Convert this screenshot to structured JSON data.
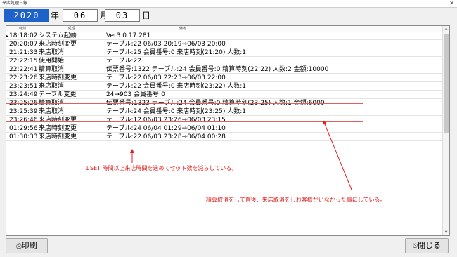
{
  "window": {
    "title": "来店処理日報",
    "close_glyph": "✕"
  },
  "date": {
    "year": "2020",
    "year_label": "年",
    "month": "06",
    "month_label": "月",
    "day": "03",
    "day_label": "日"
  },
  "list": {
    "headers": {
      "time": "時刻",
      "action": "処理",
      "detail": "備考"
    },
    "row_marker": "▸",
    "rows": [
      {
        "time": "18:18:02",
        "action": "システム起動",
        "detail": "Ver3.0.17.281"
      },
      {
        "time": "20:20:07",
        "action": "来店時刻変更",
        "detail": "テーブル:22 06/03 20:19→06/03 20:00"
      },
      {
        "time": "21:21:33",
        "action": "来店取消",
        "detail": "テーブル:25 会員番号:0 来店時刻(21:20) 人数:1"
      },
      {
        "time": "22:22:15",
        "action": "使用開始",
        "detail": "テーブル:22"
      },
      {
        "time": "22:22:41",
        "action": "精算取消",
        "detail": "伝票番号:1322 テーブル:24 会員番号:0 精算時刻(22:22) 人数:2 金額:10000"
      },
      {
        "time": "22:23:26",
        "action": "来店時刻変更",
        "detail": "テーブル:22 06/03 22:23→06/03 22:00"
      },
      {
        "time": "23:23:51",
        "action": "来店取消",
        "detail": "テーブル:22 会員番号:0 来店時刻(23:22) 人数:1"
      },
      {
        "time": "23:24:49",
        "action": "テーブル変更",
        "detail": "24→903 会員番号:0"
      },
      {
        "time": "23:25:26",
        "action": "精算取消",
        "detail": "伝票番号:1323 テーブル:24 会員番号:0 精算時刻(23:25) 人数:1 金額:6000"
      },
      {
        "time": "23:25:39",
        "action": "来店取消",
        "detail": "テーブル:24 会員番号:0 来店時刻(23:25) 人数:1"
      },
      {
        "time": "23:26:46",
        "action": "来店時刻変更",
        "detail": "テーブル:12 06/03 23:26→06/03 23:15"
      },
      {
        "time": "01:29:56",
        "action": "来店時刻変更",
        "detail": "テーブル:24 06/04 01:29→06/04 01:10"
      },
      {
        "time": "01:30:33",
        "action": "来店時刻変更",
        "detail": "テーブル:22 06/03 23:28→06/04 00:28"
      }
    ]
  },
  "annotations": {
    "note1": "１SET 時間以上来店時間を進めてセット数を減らしている。",
    "note2": "精算取消をして直後、来店取消をしお客様がいなかった事にしている。",
    "color": "#e02020"
  },
  "buttons": {
    "print": "印刷",
    "print_icon": "⎙",
    "close": "閉じる",
    "close_icon": "⎋"
  }
}
